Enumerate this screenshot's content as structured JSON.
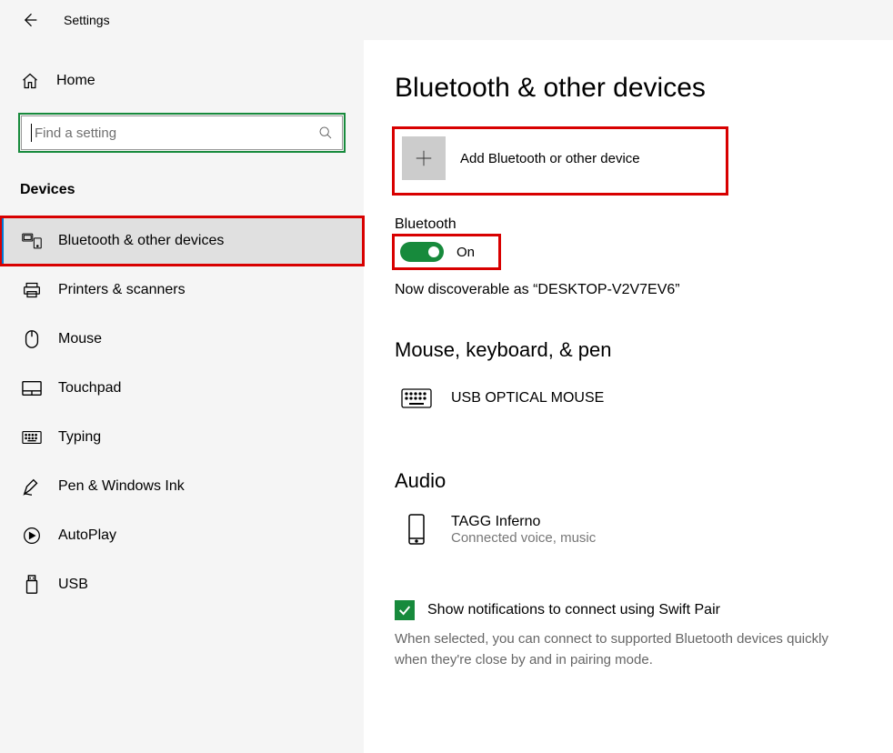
{
  "titlebar": {
    "app_title": "Settings"
  },
  "sidebar": {
    "home_label": "Home",
    "search_placeholder": "Find a setting",
    "section_header": "Devices",
    "items": [
      {
        "label": "Bluetooth & other devices",
        "icon": "bluetooth-devices-icon",
        "active": true
      },
      {
        "label": "Printers & scanners",
        "icon": "printer-icon"
      },
      {
        "label": "Mouse",
        "icon": "mouse-icon"
      },
      {
        "label": "Touchpad",
        "icon": "touchpad-icon"
      },
      {
        "label": "Typing",
        "icon": "keyboard-icon"
      },
      {
        "label": "Pen & Windows Ink",
        "icon": "pen-icon"
      },
      {
        "label": "AutoPlay",
        "icon": "autoplay-icon"
      },
      {
        "label": "USB",
        "icon": "usb-icon"
      }
    ]
  },
  "main": {
    "page_title": "Bluetooth & other devices",
    "add_device_label": "Add Bluetooth or other device",
    "bluetooth_label": "Bluetooth",
    "toggle_state": "On",
    "discoverable_text": "Now discoverable as “DESKTOP-V2V7EV6”",
    "sections": {
      "mouse_keyboard_pen": {
        "heading": "Mouse, keyboard, & pen",
        "devices": [
          {
            "name": "USB OPTICAL MOUSE",
            "status": "",
            "icon": "keyboard-device-icon"
          }
        ]
      },
      "audio": {
        "heading": "Audio",
        "devices": [
          {
            "name": "TAGG Inferno",
            "status": "Connected voice, music",
            "icon": "phone-device-icon"
          }
        ]
      }
    },
    "swift_pair": {
      "checked": true,
      "label": "Show notifications to connect using Swift Pair",
      "description": "When selected, you can connect to supported Bluetooth devices quickly when they're close by and in pairing mode."
    }
  },
  "annotations": {
    "highlight_color_red": "#d80000",
    "highlight_color_green": "#178a3c"
  }
}
